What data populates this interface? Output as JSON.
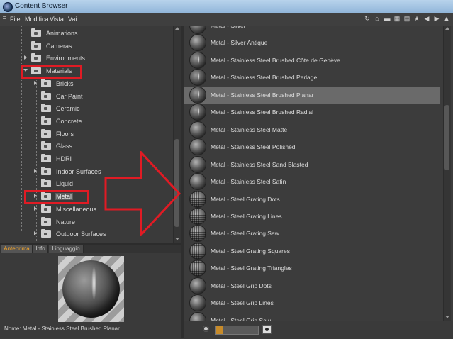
{
  "window": {
    "title": "Content Browser"
  },
  "menu": [
    "File",
    "Modifica",
    "Vista",
    "Vai"
  ],
  "toolbar_icons": [
    "refresh-icon",
    "home-icon",
    "folder-icon",
    "grid-view-icon",
    "list-view-icon",
    "star-icon",
    "back-icon",
    "forward-icon",
    "up-icon"
  ],
  "tree": {
    "items": [
      {
        "label": "Animations",
        "level": 1,
        "expandable": false
      },
      {
        "label": "Cameras",
        "level": 1,
        "expandable": false
      },
      {
        "label": "Environments",
        "level": 1,
        "expandable": true
      },
      {
        "label": "Materials",
        "level": 1,
        "expandable": true,
        "expanded": true
      },
      {
        "label": "Bricks",
        "level": 2,
        "expandable": true
      },
      {
        "label": "Car Paint",
        "level": 2,
        "expandable": false
      },
      {
        "label": "Ceramic",
        "level": 2,
        "expandable": false
      },
      {
        "label": "Concrete",
        "level": 2,
        "expandable": false
      },
      {
        "label": "Floors",
        "level": 2,
        "expandable": false
      },
      {
        "label": "Glass",
        "level": 2,
        "expandable": false
      },
      {
        "label": "HDRI",
        "level": 2,
        "expandable": false
      },
      {
        "label": "Indoor Surfaces",
        "level": 2,
        "expandable": true
      },
      {
        "label": "Liquid",
        "level": 2,
        "expandable": false
      },
      {
        "label": "Metal",
        "level": 2,
        "expandable": true,
        "selected": true
      },
      {
        "label": "Miscellaneous",
        "level": 2,
        "expandable": true
      },
      {
        "label": "Nature",
        "level": 2,
        "expandable": false
      },
      {
        "label": "Outdoor Surfaces",
        "level": 2,
        "expandable": true
      }
    ]
  },
  "tabs": [
    {
      "label": "Anteprima",
      "active": true
    },
    {
      "label": "Info",
      "active": false
    },
    {
      "label": "Linguaggio",
      "active": false
    }
  ],
  "preview": {
    "name_label": "Nome:",
    "name_value": "Metal - Stainless Steel Brushed Planar"
  },
  "list": {
    "items": [
      {
        "label": "Metal - Silver",
        "thumb": "plain"
      },
      {
        "label": "Metal - Silver Antique",
        "thumb": "plain"
      },
      {
        "label": "Metal - Stainless Steel Brushed Côte de Genève",
        "thumb": "streak"
      },
      {
        "label": "Metal - Stainless Steel Brushed Perlage",
        "thumb": "streak"
      },
      {
        "label": "Metal - Stainless Steel Brushed Planar",
        "thumb": "streak",
        "selected": true
      },
      {
        "label": "Metal - Stainless Steel Brushed Radial",
        "thumb": "streak"
      },
      {
        "label": "Metal - Stainless Steel Matte",
        "thumb": "plain"
      },
      {
        "label": "Metal - Stainless Steel Polished",
        "thumb": "plain"
      },
      {
        "label": "Metal - Stainless Steel Sand Blasted",
        "thumb": "plain"
      },
      {
        "label": "Metal - Stainless Steel Satin",
        "thumb": "plain"
      },
      {
        "label": "Metal - Steel Grating Dots",
        "thumb": "grating"
      },
      {
        "label": "Metal - Steel Grating Lines",
        "thumb": "grating"
      },
      {
        "label": "Metal - Steel Grating Saw",
        "thumb": "grating"
      },
      {
        "label": "Metal - Steel Grating Squares",
        "thumb": "grating"
      },
      {
        "label": "Metal - Steel Grating Triangles",
        "thumb": "grating"
      },
      {
        "label": "Metal - Steel Grip Dots",
        "thumb": "plain"
      },
      {
        "label": "Metal - Steel Grip Lines",
        "thumb": "plain"
      },
      {
        "label": "Metal - Steel Grip Saw",
        "thumb": "plain"
      }
    ]
  },
  "colors": {
    "highlight": "#e01b24",
    "active_tab": "#f4a52a",
    "background": "#3c3c3c"
  }
}
